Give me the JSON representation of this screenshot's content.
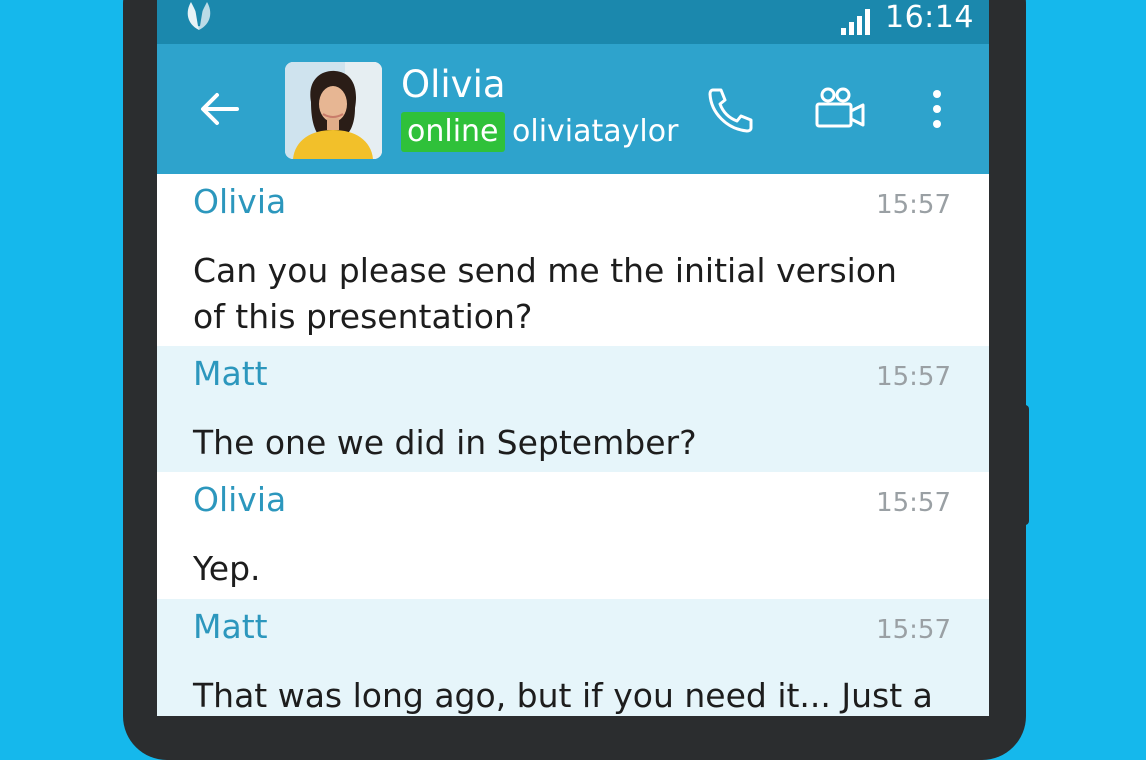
{
  "status_bar": {
    "time": "16:14"
  },
  "chat_header": {
    "contact_name": "Olivia",
    "status": "online",
    "username": "oliviataylor"
  },
  "messages": [
    {
      "sender": "Olivia",
      "time": "15:57",
      "text": "Can you please send me the initial version of this presentation?"
    },
    {
      "sender": "Matt",
      "time": "15:57",
      "text": "The one we did in September?"
    },
    {
      "sender": "Olivia",
      "time": "15:57",
      "text": "Yep."
    },
    {
      "sender": "Matt",
      "time": "15:57",
      "text": "That was long ago, but if you need it... Just a"
    }
  ],
  "icons": {
    "back": "arrow-back-icon",
    "call": "phone-icon",
    "video": "video-camera-icon",
    "menu": "more-vertical-icon",
    "app": "app-logo-icon",
    "signal": "signal-icon"
  },
  "colors": {
    "background": "#15b8ec",
    "status_bar": "#1b88ad",
    "app_bar": "#2ea3cc",
    "online_badge": "#2fc13a",
    "sender_name": "#2c97bd",
    "outgoing_bg": "#e6f5fa"
  }
}
